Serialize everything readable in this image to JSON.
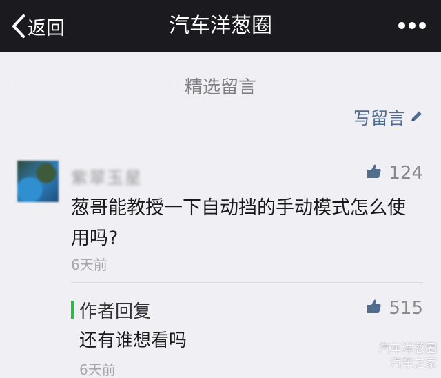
{
  "navbar": {
    "back_label": "返回",
    "title": "汽车洋葱圈"
  },
  "section": {
    "title": "精选留言",
    "write_label": "写留言"
  },
  "comment": {
    "nickname": "紫翠玉星",
    "likes": "124",
    "text": "葱哥能教授一下自动挡的手动模式怎么使用吗?",
    "time": "6天前"
  },
  "reply": {
    "label": "作者回复",
    "likes": "515",
    "text": "还有谁想看吗",
    "time": "6天前"
  },
  "watermark": {
    "line1": "汽车洋葱圈",
    "line2": "汽车之家"
  },
  "colors": {
    "navbar_bg": "#1b1b1f",
    "page_bg": "#efeff4",
    "link_blue": "#4f6d91",
    "reply_accent": "#2fb84a"
  }
}
